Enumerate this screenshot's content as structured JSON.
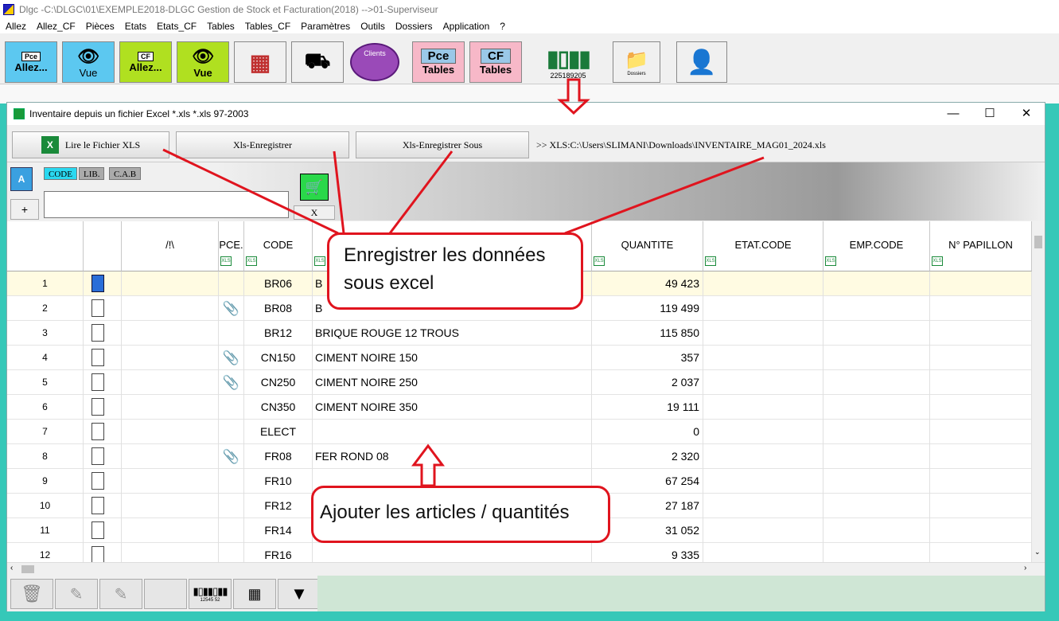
{
  "app": {
    "title": "Dlgc -C:\\DLGC\\01\\EXEMPLE2018-DLGC Gestion de Stock et Facturation(2018) -->01-Superviseur",
    "menu": [
      "Allez",
      "Allez_CF",
      "Pièces",
      "Etats",
      "Etats_CF",
      "Tables",
      "Tables_CF",
      "Paramètres",
      "Outils",
      "Dossiers",
      "Application",
      "?"
    ]
  },
  "toolbar": {
    "pce_small": "Pce",
    "allez": "Allez...",
    "vue": "Vue",
    "cf_small": "CF",
    "clients": "Clients",
    "pce": "Pce",
    "cf": "CF",
    "tables": "Tables",
    "barcode_number": "225189205",
    "dossiers": "Dossiers"
  },
  "window": {
    "title": "Inventaire depuis un fichier Excel *.xls *.xls 97-2003",
    "btn_lire": "Lire le Fichier XLS",
    "btn_enregistrer": "Xls-Enregistrer",
    "btn_enregistrer_sous": "Xls-Enregistrer Sous",
    "path": ">> XLS:C:\\Users\\SLIMANI\\Downloads\\INVENTAIRE_MAG01_2024.xls",
    "tabs": [
      "CODE",
      "LIB.",
      "C.A.B"
    ],
    "plus": "+",
    "x_label": "X"
  },
  "grid": {
    "headers": {
      "warn": "/!\\",
      "pce": "PCE.",
      "code": "CODE",
      "quantite": "QUANTITE",
      "etat_code": "ETAT.CODE",
      "emp_code": "EMP.CODE",
      "papillon": "N° PAPILLON"
    },
    "xls_badge": "XLS",
    "rows": [
      {
        "n": "1",
        "code": "BR06",
        "lib": "B",
        "qty": "49 423",
        "attach": false,
        "checked": true
      },
      {
        "n": "2",
        "code": "BR08",
        "lib": "B",
        "qty": "119 499",
        "attach": true,
        "checked": false
      },
      {
        "n": "3",
        "code": "BR12",
        "lib": "BRIQUE ROUGE 12 TROUS",
        "qty": "115 850",
        "attach": false,
        "checked": false
      },
      {
        "n": "4",
        "code": "CN150",
        "lib": "CIMENT NOIRE 150",
        "qty": "357",
        "attach": true,
        "checked": false
      },
      {
        "n": "5",
        "code": "CN250",
        "lib": "CIMENT NOIRE 250",
        "qty": "2 037",
        "attach": true,
        "checked": false
      },
      {
        "n": "6",
        "code": "CN350",
        "lib": "CIMENT NOIRE 350",
        "qty": "19 111",
        "attach": false,
        "checked": false
      },
      {
        "n": "7",
        "code": "ELECT",
        "lib": "",
        "qty": "0",
        "attach": false,
        "checked": false
      },
      {
        "n": "8",
        "code": "FR08",
        "lib": "FER ROND 08",
        "qty": "2 320",
        "attach": true,
        "checked": false
      },
      {
        "n": "9",
        "code": "FR10",
        "lib": "",
        "qty": "67 254",
        "attach": false,
        "checked": false
      },
      {
        "n": "10",
        "code": "FR12",
        "lib": "",
        "qty": "27 187",
        "attach": false,
        "checked": false
      },
      {
        "n": "11",
        "code": "FR14",
        "lib": "",
        "qty": "31 052",
        "attach": false,
        "checked": false
      },
      {
        "n": "12",
        "code": "FR16",
        "lib": "",
        "qty": "9 335",
        "attach": false,
        "checked": false
      }
    ]
  },
  "bottom": {
    "barcode_digits": "12545 52"
  },
  "annotations": {
    "save": "Enregistrer les données sous excel",
    "add": "Ajouter les articles / quantités"
  },
  "colors": {
    "accent_red": "#e0141e",
    "selection_blue": "#2a6ed8",
    "row_highlight": "#fffbe2",
    "teal_desktop": "#36c8b8"
  }
}
